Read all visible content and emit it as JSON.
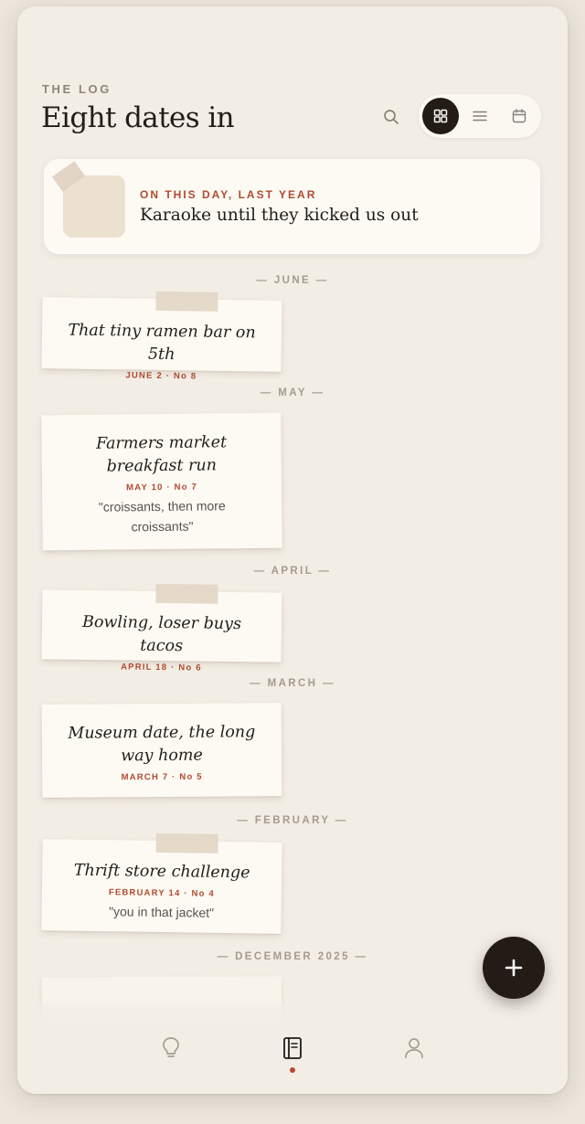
{
  "header": {
    "eyebrow": "THE LOG",
    "title": "Eight dates in"
  },
  "view_toggle": {
    "options": [
      "grid",
      "list",
      "calendar"
    ],
    "active": "grid"
  },
  "memory": {
    "label": "ON THIS DAY, LAST YEAR",
    "title": "Karaoke until they kicked us out"
  },
  "timeline": [
    {
      "month": "— JUNE —",
      "note": {
        "title": "That tiny ramen bar on 5th",
        "meta": "JUNE 2 · No 8",
        "quote": ""
      }
    },
    {
      "month": "— MAY —",
      "note": {
        "title": "Farmers market breakfast run",
        "meta": "MAY 10 · No 7",
        "quote": "\"croissants, then more croissants\""
      }
    },
    {
      "month": "— APRIL —",
      "note": {
        "title": "Bowling, loser buys tacos",
        "meta": "APRIL 18 · No 6",
        "quote": ""
      }
    },
    {
      "month": "— MARCH —",
      "note": {
        "title": "Museum date, the long way home",
        "meta": "MARCH 7 · No 5",
        "quote": ""
      }
    },
    {
      "month": "— FEBRUARY —",
      "note": {
        "title": "Thrift store challenge",
        "meta": "FEBRUARY 14 · No 4",
        "quote": "\"you in that jacket\""
      }
    },
    {
      "month": "— DECEMBER 2025 —"
    }
  ],
  "fab": {
    "icon": "plus-icon"
  },
  "bottom_nav": {
    "items": [
      "lightbulb-icon",
      "journal-icon",
      "person-icon"
    ],
    "active": "journal-icon"
  },
  "colors": {
    "background": "#f3eee5",
    "ink": "#231b16",
    "accent": "#b04a30",
    "paper": "#fdfaf3",
    "tape": "#e3d6c7"
  }
}
